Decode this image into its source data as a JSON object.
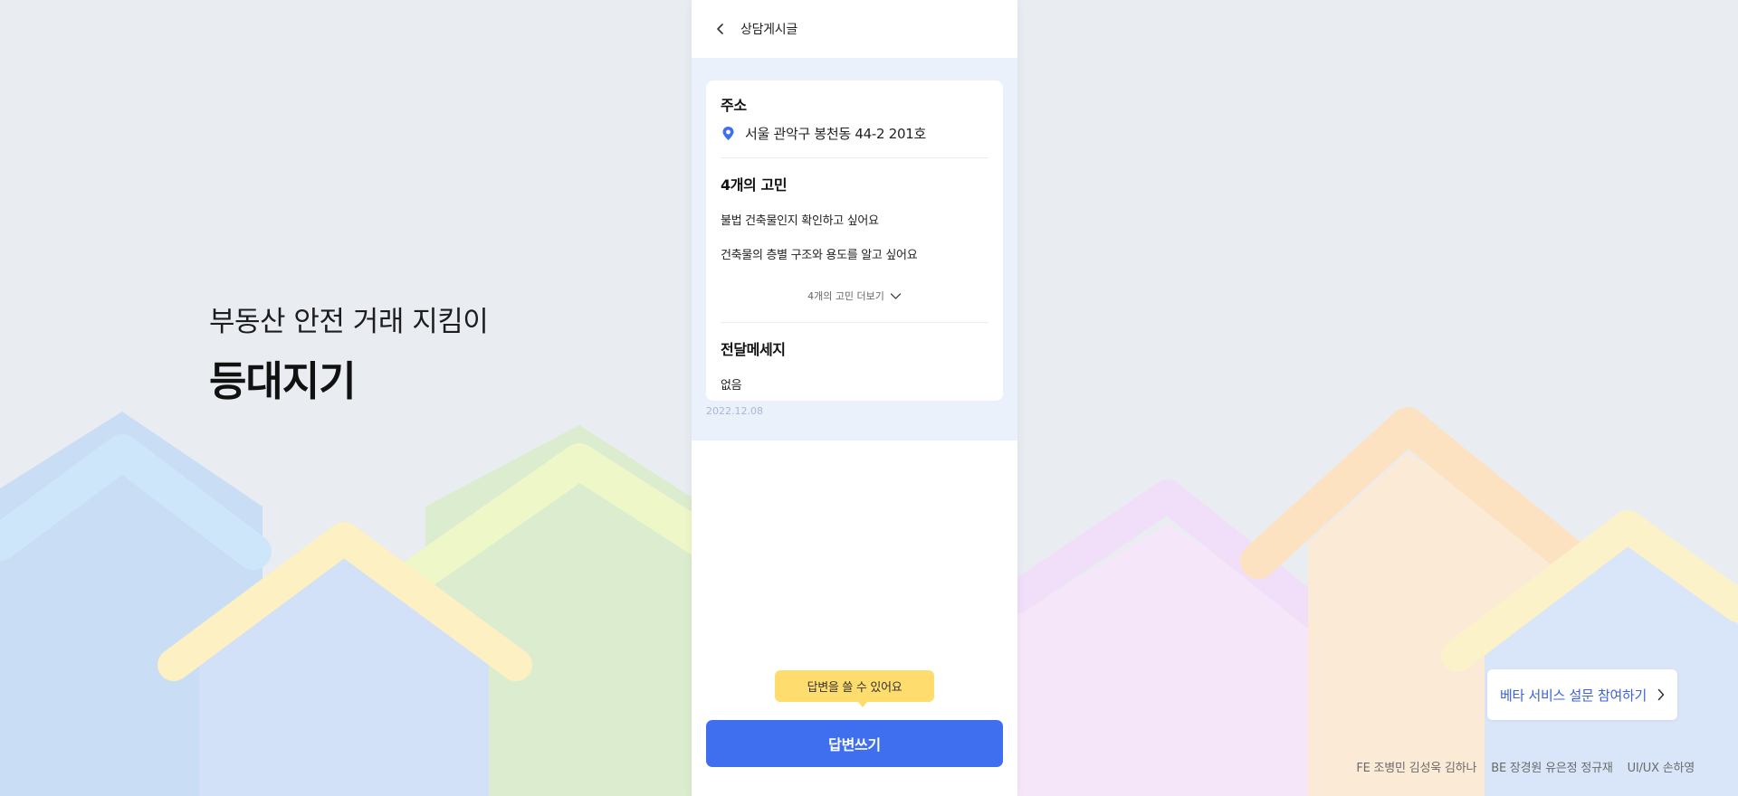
{
  "hero": {
    "subtitle": "부동산 안전 거래 지킴이",
    "title": "등대지기"
  },
  "nav": {
    "back_icon": "chevron-left-icon",
    "title": "상담게시글"
  },
  "post": {
    "address_title": "주소",
    "address_icon": "location-pin-icon",
    "address": "서울 관악구 봉천동 44-2 201호",
    "worries_title": "4개의 고민",
    "worries": [
      "불법 건축물인지 확인하고 싶어요",
      "건축물의 층별 구조와 용도를 알고 싶어요"
    ],
    "more_label": "4개의 고민 더보기",
    "more_icon": "chevron-down-icon",
    "message_title": "전달메세지",
    "message": "없음",
    "date": "2022.12.08"
  },
  "cta": {
    "tooltip": "답변을 쓸 수 있어요",
    "button_label": "답변쓰기"
  },
  "survey": {
    "label": "베타 서비스 설문 참여하기",
    "icon": "chevron-right-icon"
  },
  "credits": [
    "FE 조병민 김성욱 김하나",
    "BE 장경원 유은정 정규재",
    "UI/UX 손하영"
  ],
  "colors": {
    "primary": "#3f6fee",
    "tooltip": "#ffdc6e",
    "background": "#e9edf1",
    "content_bg": "#eaf1fb"
  }
}
